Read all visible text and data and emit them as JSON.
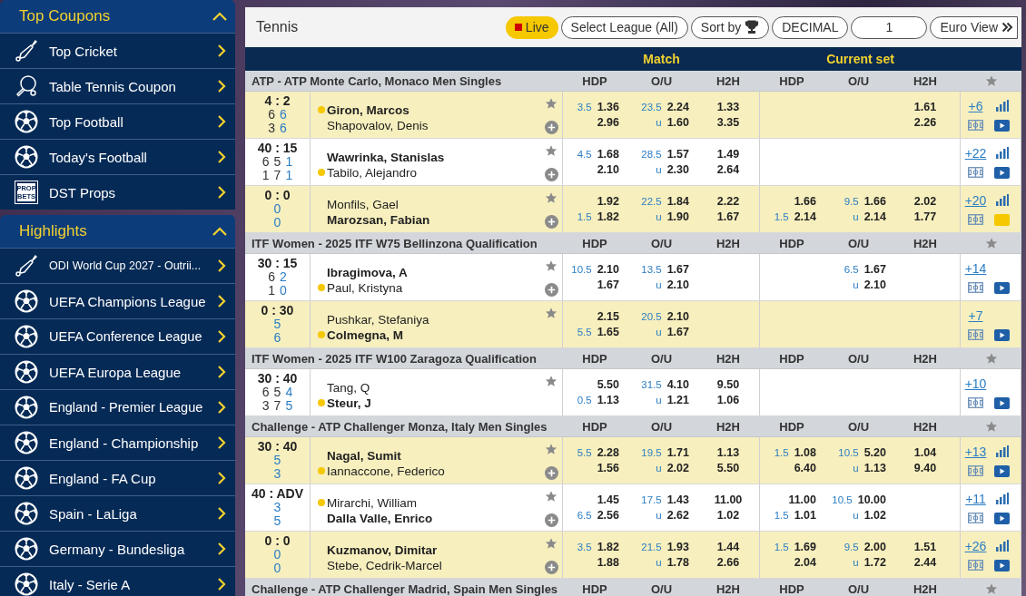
{
  "sidebar": [
    {
      "title": "Top Coupons",
      "expanded": true,
      "items": [
        {
          "label": "Top Cricket",
          "kind": "cricket"
        },
        {
          "label": "Table Tennis Coupon",
          "kind": "table-tennis"
        },
        {
          "label": "Top Football",
          "kind": "football"
        },
        {
          "label": "Today's Football",
          "kind": "football"
        },
        {
          "label": "DST Props",
          "kind": "props",
          "icon_text": [
            "PROP",
            "BETS"
          ]
        }
      ]
    },
    {
      "title": "Highlights",
      "expanded": true,
      "items": [
        {
          "label": "ODI World Cup 2027 - Outrii...",
          "kind": "cricket"
        },
        {
          "label": "UEFA Champions League",
          "kind": "football"
        },
        {
          "label": "UEFA Conference League",
          "kind": "football"
        },
        {
          "label": "UEFA Europa League",
          "kind": "football"
        },
        {
          "label": "England - Premier League",
          "kind": "football"
        },
        {
          "label": "England - Championship",
          "kind": "football"
        },
        {
          "label": "England - FA Cup",
          "kind": "football"
        },
        {
          "label": "Spain - LaLiga",
          "kind": "football"
        },
        {
          "label": "Germany - Bundesliga",
          "kind": "football"
        },
        {
          "label": "Italy - Serie A",
          "kind": "football"
        }
      ]
    }
  ],
  "main": {
    "title": "Tennis",
    "live": {
      "label": "Live",
      "on": true
    },
    "controls": [
      {
        "label": "Select League (All)",
        "kind": "plain"
      },
      {
        "label": "Sort by",
        "kind": "trophy"
      },
      {
        "label": "DECIMAL",
        "kind": "plain"
      },
      {
        "label": "1",
        "kind": "wide"
      },
      {
        "label": "Euro View",
        "kind": "chevrons"
      }
    ],
    "column_groups": [
      "Match",
      "Current set"
    ],
    "leagues": [
      {
        "name": "ATP - ATP Monte Carlo, Monaco Men Singles",
        "columns": [
          "HDP",
          "O/U",
          "H2H",
          "HDP",
          "O/U",
          "H2H"
        ],
        "matches": [
          {
            "score": "4 : 2",
            "sets": [
              [
                "6",
                "6"
              ],
              [
                "3",
                "6"
              ]
            ],
            "players": [
              {
                "name": "Giron, Marcos",
                "favorite": true,
                "serving": true
              },
              {
                "name": "Shapovalov, Denis",
                "favorite": false,
                "serving": false
              }
            ],
            "add_button": true,
            "match": {
              "hdp": [
                {
                  "line": "3.5",
                  "odd": "1.36"
                },
                {
                  "odd": "2.96"
                }
              ],
              "ou": [
                {
                  "line": "23.5",
                  "odd": "2.24"
                },
                {
                  "line": "u",
                  "odd": "1.60"
                }
              ],
              "h2h": [
                {
                  "odd": "1.33"
                },
                {
                  "odd": "3.35"
                }
              ]
            },
            "current_set": {
              "h2h": [
                {
                  "odd": "1.61"
                },
                {
                  "odd": "2.26"
                }
              ]
            },
            "more": "+6",
            "stats": true,
            "video_highlight": false
          },
          {
            "score": "40 : 15",
            "sets": [
              [
                "6",
                "5",
                "1"
              ],
              [
                "1",
                "7",
                "1"
              ]
            ],
            "players": [
              {
                "name": "Wawrinka, Stanislas",
                "favorite": true,
                "serving": false
              },
              {
                "name": "Tabilo, Alejandro",
                "favorite": false,
                "serving": true
              }
            ],
            "add_button": true,
            "match": {
              "hdp": [
                {
                  "line": "4.5",
                  "odd": "1.68"
                },
                {
                  "odd": "2.10"
                }
              ],
              "ou": [
                {
                  "line": "28.5",
                  "odd": "1.57"
                },
                {
                  "line": "u",
                  "odd": "2.30"
                }
              ],
              "h2h": [
                {
                  "odd": "1.49"
                },
                {
                  "odd": "2.64"
                }
              ]
            },
            "more": "+22",
            "stats": true,
            "video_highlight": false
          },
          {
            "score": "0 : 0",
            "sets": [
              [
                "0"
              ],
              [
                "0"
              ]
            ],
            "players": [
              {
                "name": "Monfils, Gael",
                "favorite": false,
                "serving": false
              },
              {
                "name": "Marozsan, Fabian",
                "favorite": true,
                "serving": false
              }
            ],
            "add_button": true,
            "match": {
              "hdp": [
                {
                  "odd": "1.92"
                },
                {
                  "line": "1.5",
                  "odd": "1.82"
                }
              ],
              "ou": [
                {
                  "line": "22.5",
                  "odd": "1.84"
                },
                {
                  "line": "u",
                  "odd": "1.90"
                }
              ],
              "h2h": [
                {
                  "odd": "2.22"
                },
                {
                  "odd": "1.67"
                }
              ]
            },
            "current_set": {
              "hdp": [
                {
                  "odd": "1.66"
                },
                {
                  "line": "1.5",
                  "odd": "2.14"
                }
              ],
              "ou": [
                {
                  "line": "9.5",
                  "odd": "1.66"
                },
                {
                  "line": "u",
                  "odd": "2.14"
                }
              ],
              "h2h": [
                {
                  "odd": "2.02"
                },
                {
                  "odd": "1.77"
                }
              ]
            },
            "more": "+20",
            "stats": true,
            "video_highlight": true
          }
        ]
      },
      {
        "name": "ITF Women - 2025 ITF W75 Bellinzona Qualification",
        "columns": [
          "HDP",
          "O/U",
          "H2H",
          "HDP",
          "O/U",
          "H2H"
        ],
        "matches": [
          {
            "score": "30 : 15",
            "sets": [
              [
                "6",
                "2"
              ],
              [
                "1",
                "0"
              ]
            ],
            "players": [
              {
                "name": "Ibragimova, A",
                "favorite": true,
                "serving": false
              },
              {
                "name": "Paul, Kristyna",
                "favorite": false,
                "serving": true
              }
            ],
            "add_button": true,
            "match": {
              "hdp": [
                {
                  "line": "10.5",
                  "odd": "2.10"
                },
                {
                  "odd": "1.67"
                }
              ],
              "ou": [
                {
                  "line": "13.5",
                  "odd": "1.67"
                },
                {
                  "line": "u",
                  "odd": "2.10"
                }
              ]
            },
            "current_set": {
              "ou": [
                {
                  "line": "6.5",
                  "odd": "1.67"
                },
                {
                  "line": "u",
                  "odd": "2.10"
                }
              ]
            },
            "more": "+14",
            "stats": false,
            "video_highlight": false
          },
          {
            "score": "0 : 30",
            "sets": [
              [
                "5"
              ],
              [
                "6"
              ]
            ],
            "players": [
              {
                "name": "Pushkar, Stefaniya",
                "favorite": false,
                "serving": false
              },
              {
                "name": "Colmegna, M",
                "favorite": true,
                "serving": true
              }
            ],
            "add_button": false,
            "match": {
              "hdp": [
                {
                  "odd": "2.15"
                },
                {
                  "line": "5.5",
                  "odd": "1.65"
                }
              ],
              "ou": [
                {
                  "line": "20.5",
                  "odd": "2.10"
                },
                {
                  "line": "u",
                  "odd": "1.67"
                }
              ]
            },
            "more": "+7",
            "stats": false,
            "video_highlight": false
          }
        ]
      },
      {
        "name": "ITF Women - 2025 ITF W100 Zaragoza Qualification",
        "columns": [
          "HDP",
          "O/U",
          "H2H",
          "HDP",
          "O/U",
          "H2H"
        ],
        "matches": [
          {
            "score": "30 : 40",
            "sets": [
              [
                "6",
                "5",
                "4"
              ],
              [
                "3",
                "7",
                "5"
              ]
            ],
            "players": [
              {
                "name": "Tang, Q",
                "favorite": false,
                "serving": false
              },
              {
                "name": "Steur, J",
                "favorite": true,
                "serving": true
              }
            ],
            "add_button": false,
            "match": {
              "hdp": [
                {
                  "odd": "5.50"
                },
                {
                  "line": "0.5",
                  "odd": "1.13"
                }
              ],
              "ou": [
                {
                  "line": "31.5",
                  "odd": "4.10"
                },
                {
                  "line": "u",
                  "odd": "1.21"
                }
              ],
              "h2h": [
                {
                  "odd": "9.50"
                },
                {
                  "odd": "1.06"
                }
              ]
            },
            "more": "+10",
            "stats": false,
            "video_highlight": false
          }
        ]
      },
      {
        "name": "Challenge - ATP Challenger Monza, Italy Men Singles",
        "columns": [
          "HDP",
          "O/U",
          "H2H",
          "HDP",
          "O/U",
          "H2H"
        ],
        "matches": [
          {
            "score": "30 : 40",
            "sets": [
              [
                "5"
              ],
              [
                "3"
              ]
            ],
            "players": [
              {
                "name": "Nagal, Sumit",
                "favorite": true,
                "serving": false
              },
              {
                "name": "Iannaccone, Federico",
                "favorite": false,
                "serving": true
              }
            ],
            "add_button": true,
            "match": {
              "hdp": [
                {
                  "line": "5.5",
                  "odd": "2.28"
                },
                {
                  "odd": "1.56"
                }
              ],
              "ou": [
                {
                  "line": "19.5",
                  "odd": "1.71"
                },
                {
                  "line": "u",
                  "odd": "2.02"
                }
              ],
              "h2h": [
                {
                  "odd": "1.13"
                },
                {
                  "odd": "5.50"
                }
              ]
            },
            "current_set": {
              "hdp": [
                {
                  "line": "1.5",
                  "odd": "1.08"
                },
                {
                  "odd": "6.40"
                }
              ],
              "ou": [
                {
                  "line": "10.5",
                  "odd": "5.20"
                },
                {
                  "line": "u",
                  "odd": "1.13"
                }
              ],
              "h2h": [
                {
                  "odd": "1.04"
                },
                {
                  "odd": "9.40"
                }
              ]
            },
            "more": "+13",
            "stats": true,
            "video_highlight": false
          },
          {
            "score": "40 : ADV",
            "sets": [
              [
                "3"
              ],
              [
                "5"
              ]
            ],
            "players": [
              {
                "name": "Mirarchi, William",
                "favorite": false,
                "serving": true
              },
              {
                "name": "Dalla Valle, Enrico",
                "favorite": true,
                "serving": false
              }
            ],
            "add_button": true,
            "match": {
              "hdp": [
                {
                  "odd": "1.45"
                },
                {
                  "line": "6.5",
                  "odd": "2.56"
                }
              ],
              "ou": [
                {
                  "line": "17.5",
                  "odd": "1.43"
                },
                {
                  "line": "u",
                  "odd": "2.62"
                }
              ],
              "h2h": [
                {
                  "odd": "11.00"
                },
                {
                  "odd": "1.02"
                }
              ]
            },
            "current_set": {
              "hdp": [
                {
                  "odd": "11.00"
                },
                {
                  "line": "1.5",
                  "odd": "1.01"
                }
              ],
              "ou": [
                {
                  "line": "10.5",
                  "odd": "10.00"
                },
                {
                  "line": "u",
                  "odd": "1.02"
                }
              ]
            },
            "more": "+11",
            "stats": true,
            "video_highlight": false
          },
          {
            "score": "0 : 0",
            "sets": [
              [
                "0"
              ],
              [
                "0"
              ]
            ],
            "players": [
              {
                "name": "Kuzmanov, Dimitar",
                "favorite": true,
                "serving": false
              },
              {
                "name": "Stebe, Cedrik-Marcel",
                "favorite": false,
                "serving": false
              }
            ],
            "add_button": true,
            "match": {
              "hdp": [
                {
                  "line": "3.5",
                  "odd": "1.82"
                },
                {
                  "odd": "1.88"
                }
              ],
              "ou": [
                {
                  "line": "21.5",
                  "odd": "1.93"
                },
                {
                  "line": "u",
                  "odd": "1.78"
                }
              ],
              "h2h": [
                {
                  "odd": "1.44"
                },
                {
                  "odd": "2.66"
                }
              ]
            },
            "current_set": {
              "hdp": [
                {
                  "line": "1.5",
                  "odd": "1.69"
                },
                {
                  "odd": "2.04"
                }
              ],
              "ou": [
                {
                  "line": "9.5",
                  "odd": "2.00"
                },
                {
                  "line": "u",
                  "odd": "1.72"
                }
              ],
              "h2h": [
                {
                  "odd": "1.51"
                },
                {
                  "odd": "2.44"
                }
              ]
            },
            "more": "+26",
            "stats": true,
            "video_highlight": false
          }
        ]
      },
      {
        "name": "Challenge - ATP Challenger Madrid, Spain Men Singles",
        "columns": [
          "HDP",
          "O/U",
          "H2H",
          "HDP",
          "O/U",
          "H2H"
        ]
      }
    ]
  }
}
